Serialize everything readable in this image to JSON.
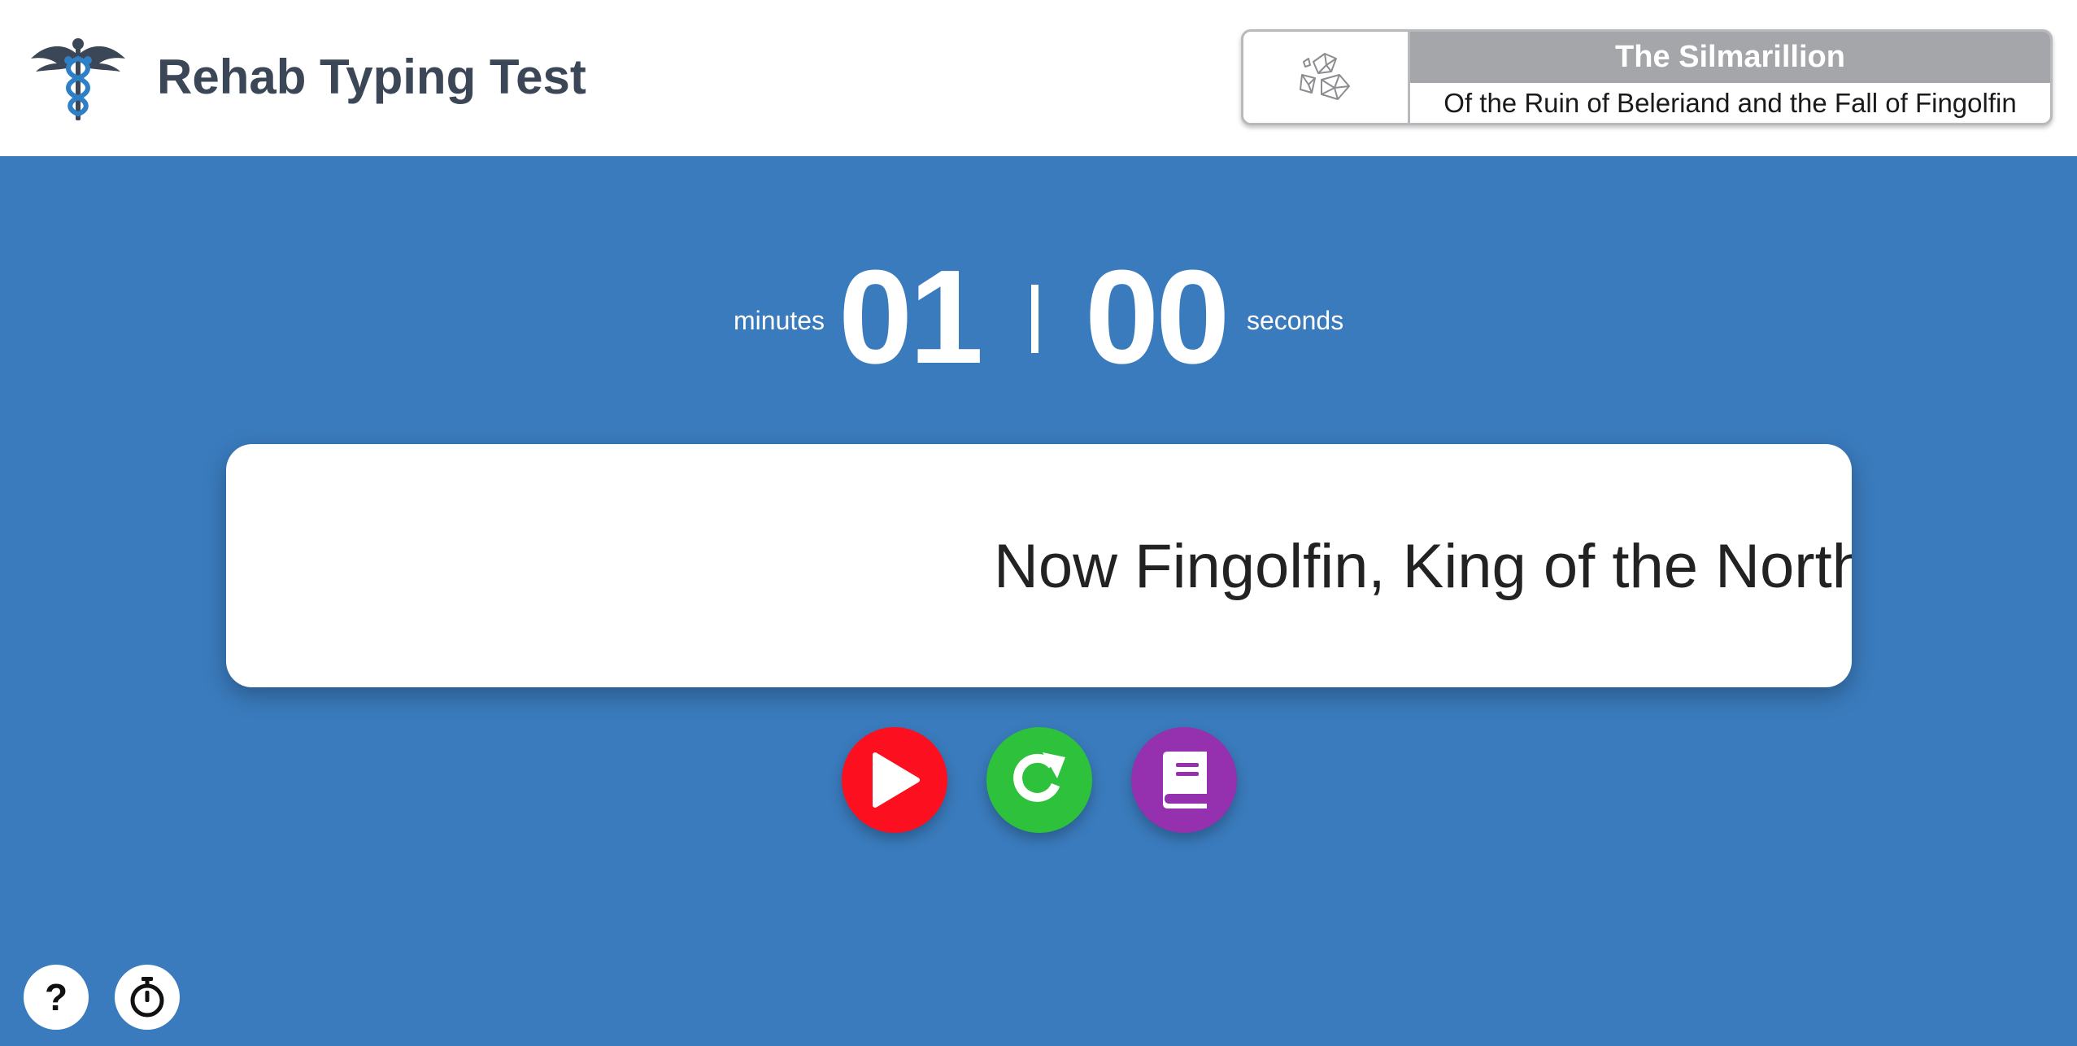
{
  "app": {
    "title": "Rehab Typing Test",
    "logo_icon": "caduceus-icon"
  },
  "book": {
    "cover_icon": "crystals-icon",
    "title": "The Silmarillion",
    "chapter": "Of the Ruin of Beleriand and the Fall of Fingolfin"
  },
  "timer": {
    "minutes_label": "minutes",
    "minutes": "01",
    "seconds": "00",
    "seconds_label": "seconds"
  },
  "typing": {
    "text": "Now Fingolfin, King of the Northmen"
  },
  "controls": {
    "play_icon": "play-icon",
    "restart_icon": "restart-icon",
    "book_icon": "book-icon"
  },
  "footer": {
    "help_label": "?",
    "timer_icon": "stopwatch-icon"
  },
  "colors": {
    "background": "#3a7bbd",
    "header_title": "#3b4656",
    "play": "#fc1020",
    "restart": "#2ec23c",
    "book": "#9530ae",
    "book_title_bar": "#a5a6a9"
  }
}
